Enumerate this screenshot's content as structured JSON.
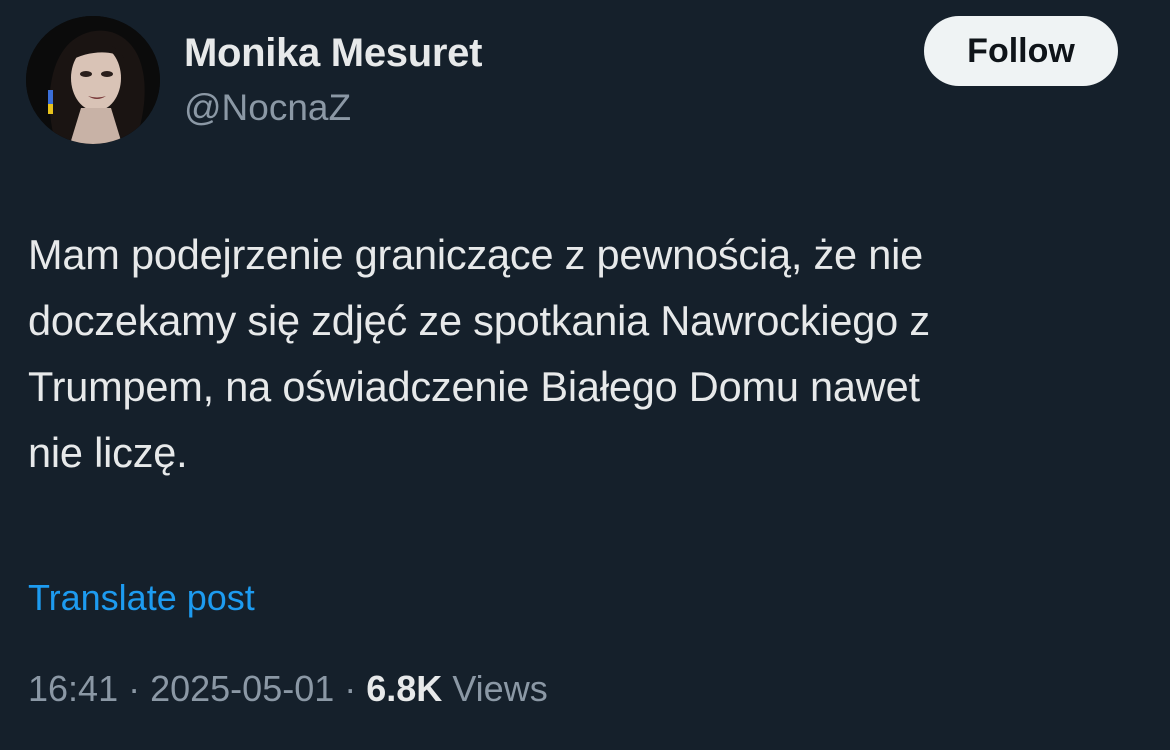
{
  "author": {
    "name": "Monika Mesuret",
    "handle": "@NocnaZ"
  },
  "follow_button": {
    "label": "Follow"
  },
  "post": {
    "lines": [
      "Mam podejrzenie graniczące z pewnością, że nie",
      "doczekamy się zdjęć ze spotkania Nawrockiego z",
      "Trumpem, na oświadczenie Białego Domu nawet",
      "nie liczę."
    ]
  },
  "translate": {
    "label": "Translate post"
  },
  "meta": {
    "time": "16:41",
    "separator": " · ",
    "date": "2025-05-01",
    "views_count": "6.8K",
    "views_label": "Views"
  },
  "colors": {
    "background": "#15202b",
    "text_primary": "#e7e9ea",
    "text_secondary": "#8b98a5",
    "link": "#1d9bf0",
    "follow_bg": "#eff3f4"
  },
  "icons": {
    "avatar": "profile-photo"
  }
}
